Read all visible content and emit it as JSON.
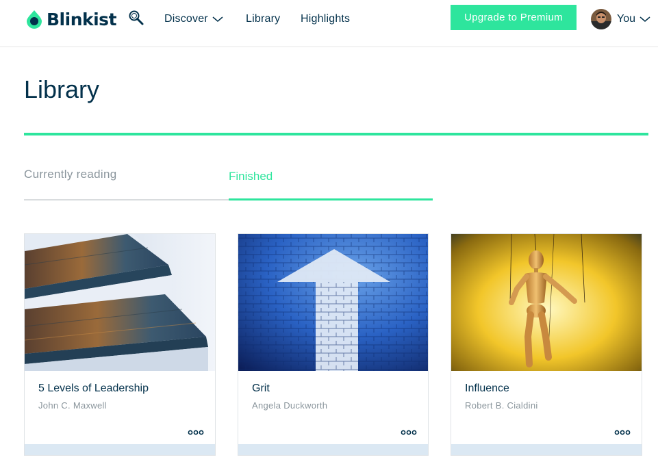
{
  "header": {
    "logo_text": "Blinkist",
    "nav": {
      "discover": "Discover",
      "library": "Library",
      "highlights": "Highlights"
    },
    "upgrade_label": "Upgrade to Premium",
    "user_label": "You"
  },
  "page": {
    "title": "Library"
  },
  "tabs": [
    {
      "label": "Currently reading",
      "active": false
    },
    {
      "label": "Finished",
      "active": true
    }
  ],
  "books": [
    {
      "title": "5 Levels of Leadership",
      "author": "John C. Maxwell",
      "cover_icon": "stairs-image"
    },
    {
      "title": "Grit",
      "author": "Angela Duckworth",
      "cover_icon": "arrow-up-image"
    },
    {
      "title": "Influence",
      "author": "Robert B. Cialdini",
      "cover_icon": "puppet-image"
    }
  ],
  "colors": {
    "brand": "#2ee59d",
    "text": "#03314b",
    "muted": "#8a959c"
  }
}
